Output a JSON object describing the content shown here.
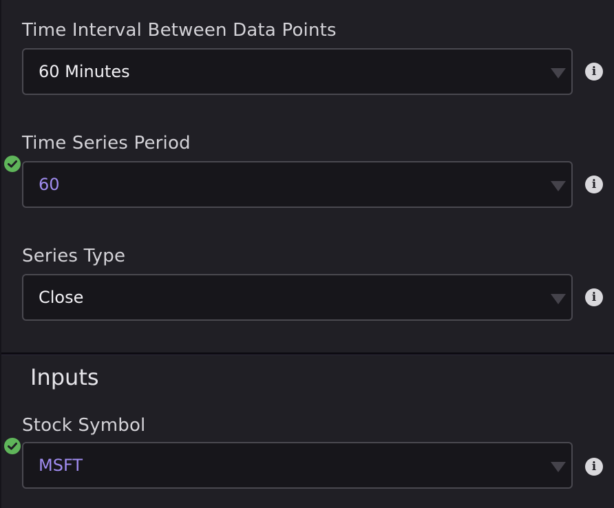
{
  "fields": [
    {
      "label": "Time Interval Between Data Points",
      "value": "60 Minutes",
      "linked": false
    },
    {
      "label": "Time Series Period",
      "value": "60",
      "linked": true
    },
    {
      "label": "Series Type",
      "value": "Close",
      "linked": false
    }
  ],
  "inputs_section": {
    "title": "Inputs",
    "fields": [
      {
        "label": "Stock Symbol",
        "value": "MSFT",
        "linked": true
      }
    ]
  },
  "icons": {
    "info": "info-icon",
    "linked_indicator": "check-circle-icon",
    "dropdown": "chevron-down-icon",
    "info_glyph": "i"
  },
  "colors": {
    "background": "#201f25",
    "linked_value": "#a08cf0",
    "check_badge": "#5fb55a"
  }
}
